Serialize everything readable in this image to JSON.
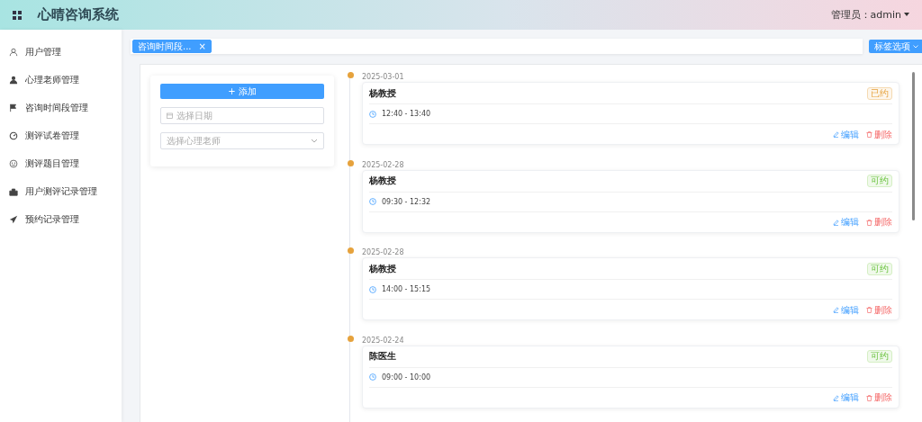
{
  "header": {
    "title": "心晴咨询系统",
    "user": "管理员：admin"
  },
  "sidebar": {
    "items": [
      {
        "label": "用户管理"
      },
      {
        "label": "心理老师管理"
      },
      {
        "label": "咨询时间段管理"
      },
      {
        "label": "测评试卷管理"
      },
      {
        "label": "测评题目管理"
      },
      {
        "label": "用户测评记录管理"
      },
      {
        "label": "预约记录管理"
      }
    ]
  },
  "tabs": [
    {
      "label": "咨询时间段...",
      "close": "×",
      "selected": true
    }
  ],
  "tab_options": "标签选项",
  "filter": {
    "add_button": "添加",
    "add_icon": "+",
    "date_placeholder": "选择日期",
    "teacher_placeholder": "选择心理老师"
  },
  "slots": [
    {
      "date": "2025-03-01",
      "teacher": "杨教授",
      "time": "12:40 - 13:40",
      "status": {
        "text": "已约",
        "kind": "booked"
      },
      "edit": "编辑",
      "delete": "删除"
    },
    {
      "date": "2025-02-28",
      "teacher": "杨教授",
      "time": "09:30 - 12:32",
      "status": {
        "text": "可约",
        "kind": "available"
      },
      "edit": "编辑",
      "delete": "删除"
    },
    {
      "date": "2025-02-28",
      "teacher": "杨教授",
      "time": "14:00 - 15:15",
      "status": {
        "text": "可约",
        "kind": "available"
      },
      "edit": "编辑",
      "delete": "删除"
    },
    {
      "date": "2025-02-24",
      "teacher": "陈医生",
      "time": "09:00 - 10:00",
      "status": {
        "text": "可约",
        "kind": "available"
      },
      "edit": "编辑",
      "delete": "删除"
    }
  ]
}
